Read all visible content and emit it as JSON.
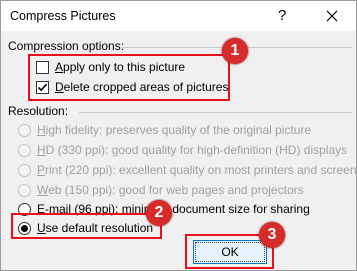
{
  "dialog": {
    "title": "Compress Pictures",
    "help_label": "?",
    "close_label": "✕"
  },
  "compression": {
    "section_label": "Compression options:",
    "options": [
      {
        "text_before": "",
        "accel": "A",
        "text_after": "pply only to this picture",
        "checked": false
      },
      {
        "text_before": "",
        "accel": "D",
        "text_after": "elete cropped areas of pictures",
        "checked": true
      }
    ]
  },
  "resolution": {
    "section_label": "Resolution:",
    "options": [
      {
        "text_before": "",
        "accel": "H",
        "text_after": "igh fidelity: preserves quality of the original picture",
        "enabled": false,
        "selected": false
      },
      {
        "text_before": "",
        "accel": "H",
        "text_after": "D (330 ppi): good quality for high-definition (HD) displays",
        "enabled": false,
        "selected": false
      },
      {
        "text_before": "",
        "accel": "P",
        "text_after": "rint (220 ppi): excellent quality on most printers and screens",
        "enabled": false,
        "selected": false
      },
      {
        "text_before": "",
        "accel": "W",
        "text_after": "eb (150 ppi): good for web pages and projectors",
        "enabled": false,
        "selected": false
      },
      {
        "text_before": "",
        "accel": "E",
        "text_after": "-mail (96 ppi): minimize document size for sharing",
        "enabled": true,
        "selected": false
      },
      {
        "text_before": "",
        "accel": "U",
        "text_after": "se default resolution",
        "enabled": true,
        "selected": true
      }
    ]
  },
  "buttons": {
    "ok_label": "OK"
  },
  "annotations": {
    "badge_1": "1",
    "badge_2": "2",
    "badge_3": "3",
    "highlight_color": "#e8101e",
    "badge_color": "#d52b2b"
  }
}
